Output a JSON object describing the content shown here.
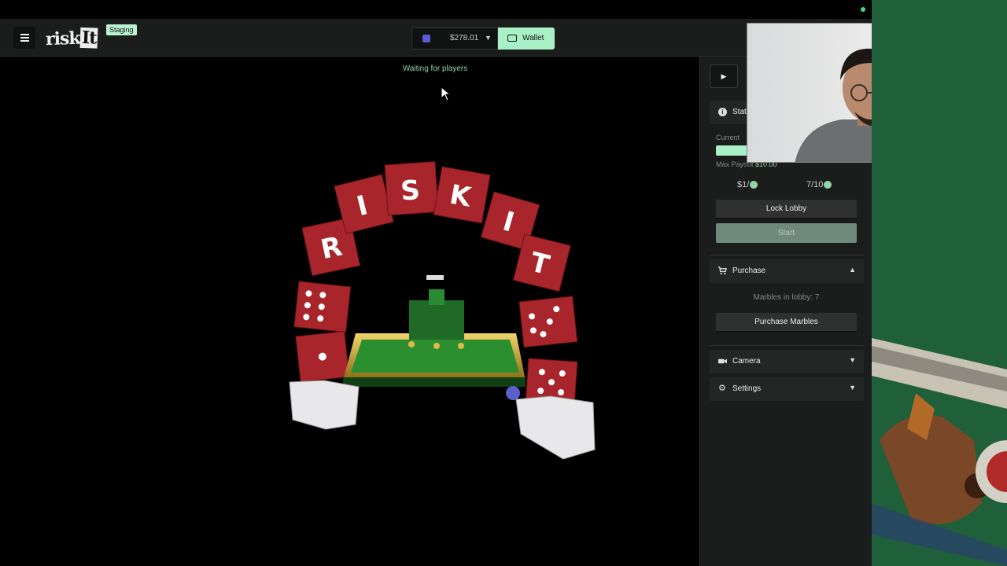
{
  "header": {
    "logo_text": "risk",
    "logo_box_text": "It",
    "staging_badge": "Staging",
    "balance": "$278.01",
    "wallet_label": "Wallet"
  },
  "game": {
    "status_text": "Waiting for players"
  },
  "sidebar": {
    "status_title": "Stat",
    "current_label": "Current",
    "progress_fraction": 0.7,
    "max_payout_label": "Max Payout",
    "max_payout_value": "$10.00",
    "stat_left": "$1/",
    "stat_right": "7/10",
    "lock_lobby_label": "Lock Lobby",
    "start_label": "Start",
    "purchase_title": "Purchase",
    "marbles_in_lobby": "Marbles in lobby: 7",
    "purchase_marbles_label": "Purchase Marbles",
    "camera_title": "Camera",
    "settings_title": "Settings"
  },
  "colors": {
    "accent": "#a8f0c6",
    "status_green": "#8fd6a6",
    "panel_bg": "#1b1d1c"
  },
  "icons": [
    "menu-icon",
    "coin-icon",
    "chevron-down-icon",
    "wallet-icon",
    "play-icon",
    "info-icon",
    "cart-icon",
    "chevron-up-icon",
    "camera-icon",
    "gear-icon",
    "cursor-icon"
  ]
}
